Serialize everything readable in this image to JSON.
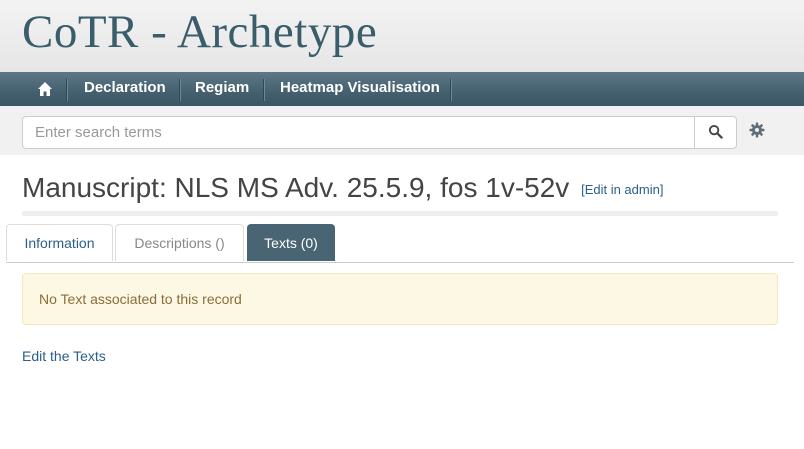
{
  "site": {
    "title": "CoTR - Archetype"
  },
  "nav": {
    "items": [
      {
        "label": "Declaration"
      },
      {
        "label": "Regiam"
      },
      {
        "label": "Heatmap Visualisation"
      }
    ]
  },
  "search": {
    "placeholder": "Enter search terms",
    "value": ""
  },
  "page": {
    "title": "Manuscript: NLS MS Adv. 25.5.9, fos 1v-52v",
    "edit_link": "[Edit in admin]"
  },
  "tabs": [
    {
      "label": "Information"
    },
    {
      "label": "Descriptions ()"
    },
    {
      "label": "Texts (0)",
      "active": true
    }
  ],
  "alert": {
    "text": "No Text associated to this record"
  },
  "footer_link": "Edit the Texts",
  "colors": {
    "navbar": "#44606f",
    "active_tab": "#496574",
    "title": "#3a5d6b",
    "link": "#2a5f8a",
    "alert_bg": "#fcf8e3"
  }
}
